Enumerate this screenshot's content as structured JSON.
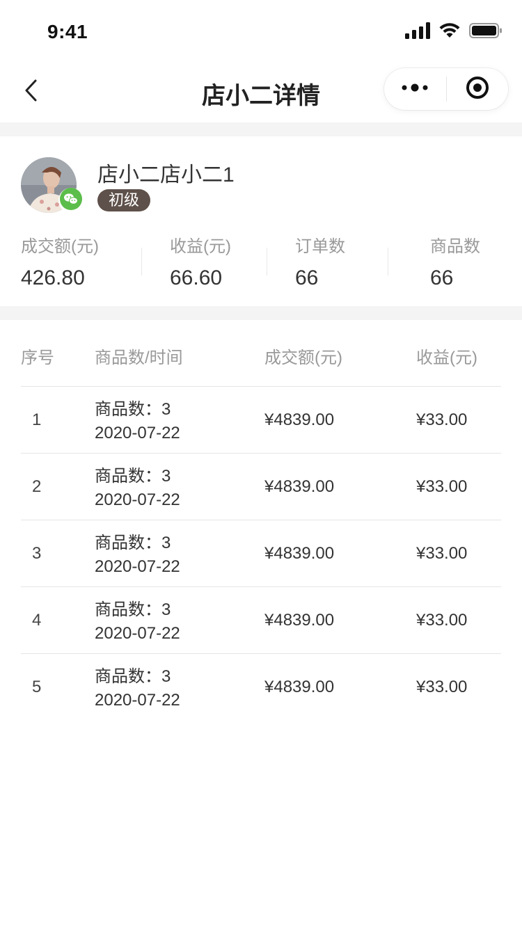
{
  "status_bar": {
    "time": "9:41"
  },
  "nav": {
    "title": "店小二详情"
  },
  "profile": {
    "name": "店小二店小二1",
    "level": "初级"
  },
  "stats": [
    {
      "label": "成交额(元)",
      "value": "426.80"
    },
    {
      "label": "收益(元)",
      "value": "66.60"
    },
    {
      "label": "订单数",
      "value": "66"
    },
    {
      "label": "商品数",
      "value": "66"
    }
  ],
  "table": {
    "headers": [
      "序号",
      "商品数/时间",
      "成交额(元)",
      "收益(元)"
    ],
    "rows": [
      {
        "index": "1",
        "goods": "商品数：3",
        "date": "2020-07-22",
        "amount": "¥4839.00",
        "income": "¥33.00"
      },
      {
        "index": "2",
        "goods": "商品数：3",
        "date": "2020-07-22",
        "amount": "¥4839.00",
        "income": "¥33.00"
      },
      {
        "index": "3",
        "goods": "商品数：3",
        "date": "2020-07-22",
        "amount": "¥4839.00",
        "income": "¥33.00"
      },
      {
        "index": "4",
        "goods": "商品数：3",
        "date": "2020-07-22",
        "amount": "¥4839.00",
        "income": "¥33.00"
      },
      {
        "index": "5",
        "goods": "商品数：3",
        "date": "2020-07-22",
        "amount": "¥4839.00",
        "income": "¥33.00"
      }
    ]
  },
  "icons": {
    "back": "chevron-left-icon",
    "more": "more-dots-icon",
    "close": "target-circle-icon",
    "wechat": "wechat-icon",
    "signal": "signal-icon",
    "wifi": "wifi-icon",
    "battery": "battery-icon"
  },
  "colors": {
    "level_badge": "#5e504a",
    "wechat_green": "#5bbd4a",
    "section_gap": "#f4f4f4"
  }
}
